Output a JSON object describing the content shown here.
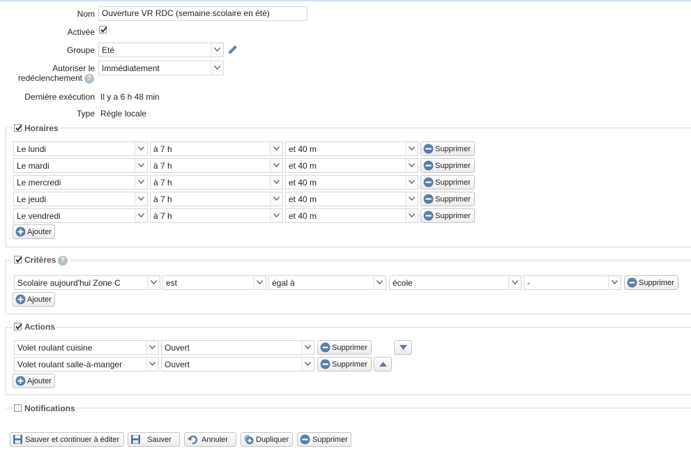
{
  "form": {
    "name_label": "Nom",
    "name_value": "Ouverture VR RDC (semaine scolaire en été)",
    "active_label": "Activée",
    "active_checked": true,
    "group_label": "Groupe",
    "group_value": "Eté",
    "retrigger_label_line1": "Autoriser le",
    "retrigger_label_line2": "redéclenchement",
    "retrigger_value": "Immédiatement",
    "last_exec_label": "Dernière exécution",
    "last_exec_value": "Il y a 6 h 48 min",
    "type_label": "Type",
    "type_value": "Règle locale"
  },
  "schedules": {
    "legend": "Horaires",
    "checked": true,
    "rows": [
      {
        "day": "Le lundi",
        "hour": "à 7 h",
        "minute": "et 40 m",
        "delete_label": "Supprimer"
      },
      {
        "day": "Le mardi",
        "hour": "à 7 h",
        "minute": "et 40 m",
        "delete_label": "Supprimer"
      },
      {
        "day": "Le mercredi",
        "hour": "à 7 h",
        "minute": "et 40 m",
        "delete_label": "Supprimer"
      },
      {
        "day": "Le jeudi",
        "hour": "à 7 h",
        "minute": "et 40 m",
        "delete_label": "Supprimer"
      },
      {
        "day": "Le vendredi",
        "hour": "à 7 h",
        "minute": "et 40 m",
        "delete_label": "Supprimer"
      }
    ],
    "add_label": "Ajouter"
  },
  "criteria": {
    "legend": "Critères",
    "checked": true,
    "rows": [
      {
        "subject": "Scolaire aujourd'hui Zone C",
        "verb": "est",
        "operator": "égal à",
        "value": "école",
        "extra": "-",
        "delete_label": "Supprimer"
      }
    ],
    "add_label": "Ajouter"
  },
  "actions": {
    "legend": "Actions",
    "checked": true,
    "rows": [
      {
        "device": "Volet roulant cuisine",
        "state": "Ouvert",
        "delete_label": "Supprimer"
      },
      {
        "device": "Volet roulant salle-à-manger",
        "state": "Ouvert",
        "delete_label": "Supprimer"
      }
    ],
    "add_label": "Ajouter"
  },
  "notifications": {
    "legend": "Notifications",
    "checked": false
  },
  "footer": {
    "save_continue": "Sauver et continuer à éditer",
    "save": "Sauver",
    "cancel": "Annuler",
    "duplicate": "Dupliquer",
    "delete": "Supprimer"
  },
  "colors": {
    "icon_blue": "#5b7ea8",
    "pencil": "#6a87ad"
  }
}
